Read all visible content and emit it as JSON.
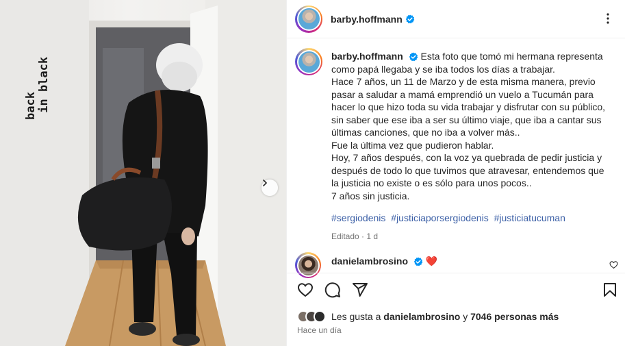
{
  "post": {
    "author": "barby.hoffmann",
    "photo_overlay_text": "back\n in black",
    "caption": "Esta foto que tomó mi hermana representa como papá llegaba y se iba todos los días a trabajar.\nHace 7 años, un 11 de Marzo y de esta misma manera, previo pasar a saludar a mamá emprendió un vuelo a Tucumán para hacer lo que hizo toda su vida trabajar y disfrutar con su público, sin saber que ese iba a ser su último viaje, que iba a cantar sus últimas canciones, que no iba a volver más..\nFue la última vez que pudieron hablar.\nHoy, 7 años después, con la voz ya quebrada de pedir justicia y después de todo lo que tuvimos que atravesar, entendemos que la justicia no existe o es sólo para unos pocos..\n7 años sin justicia.",
    "hashtags": [
      "#sergiodenis",
      "#justiciaporsergiodenis",
      "#justiciatucuman"
    ],
    "edited_label": "Editado · 1 d",
    "likes_prefix": "Les gusta a",
    "likes_user": "danielambrosino",
    "likes_connector": "y",
    "likes_count": "7046 personas más",
    "time_ago": "Hace un día"
  },
  "comment": {
    "user": "danielambrosino",
    "emoji": "❤️"
  },
  "icons": {
    "verified": "verified-badge-icon",
    "more": "more-options-icon",
    "like": "heart-icon",
    "comment": "comment-icon",
    "share": "share-icon",
    "save": "bookmark-icon",
    "next": "chevron-right-icon"
  },
  "colors": {
    "verified": "#0095f6",
    "heart_red": "#ed4956",
    "hashtag": "#3b5fa6",
    "secondary_text": "#737373"
  }
}
